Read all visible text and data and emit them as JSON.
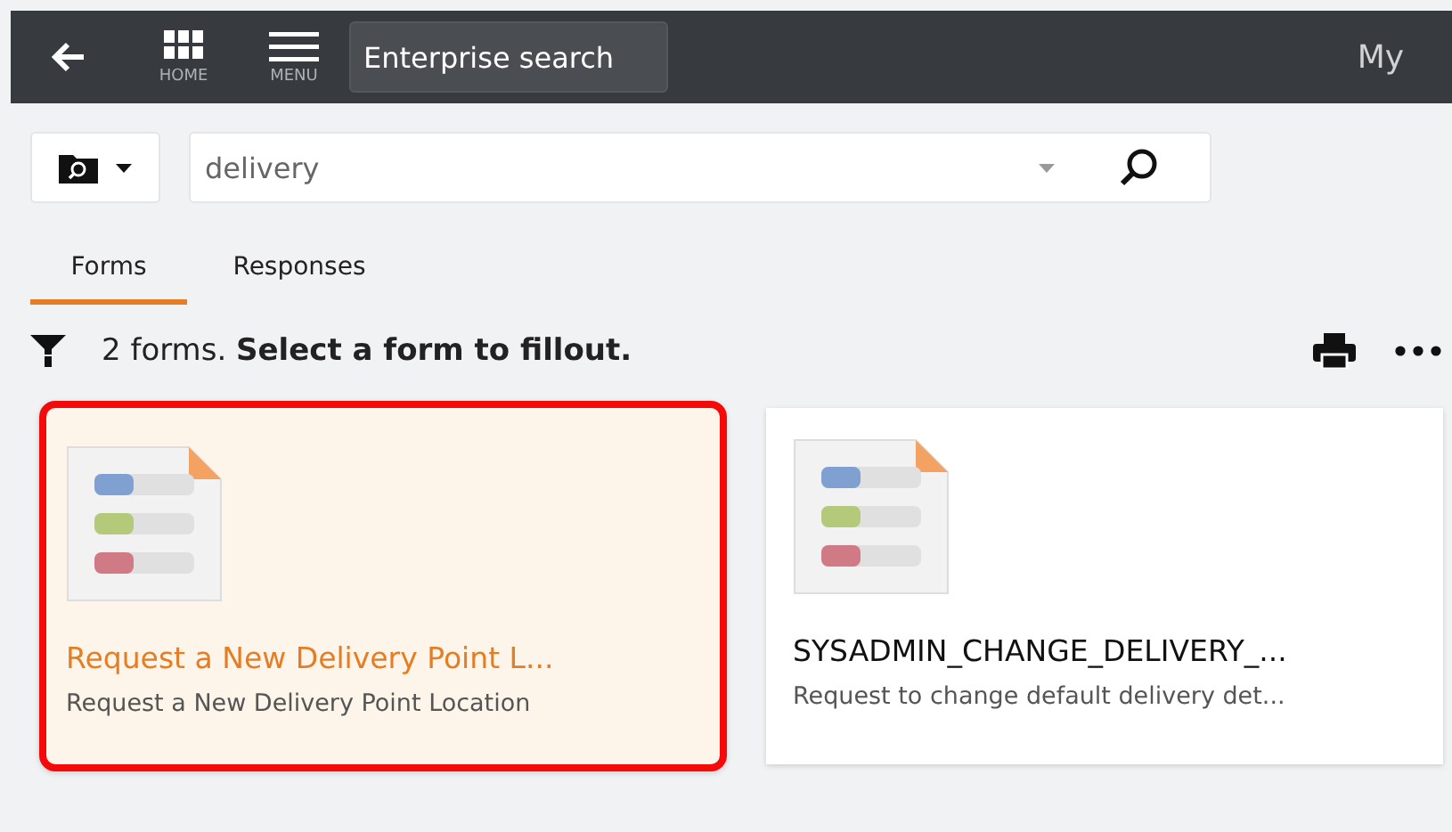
{
  "header": {
    "nav": [
      {
        "kind": "home",
        "label": "HOME"
      },
      {
        "kind": "menu",
        "label": "MENU"
      }
    ],
    "search_button": "Enterprise search",
    "user_label": "My"
  },
  "search": {
    "value": "delivery"
  },
  "tabs": [
    {
      "label": "Forms",
      "selected": true
    },
    {
      "label": "Responses",
      "selected": false
    }
  ],
  "status": {
    "text": "2 forms. **Select a form to fillout.**"
  },
  "cards": [
    {
      "title": "Request a New Delivery Point L...",
      "description": "Request a New Delivery Point Location",
      "selected": true
    },
    {
      "title": "SYSADMIN_CHANGE_DELIVERY_...",
      "description": "Request to change default delivery det...",
      "selected": false
    }
  ]
}
